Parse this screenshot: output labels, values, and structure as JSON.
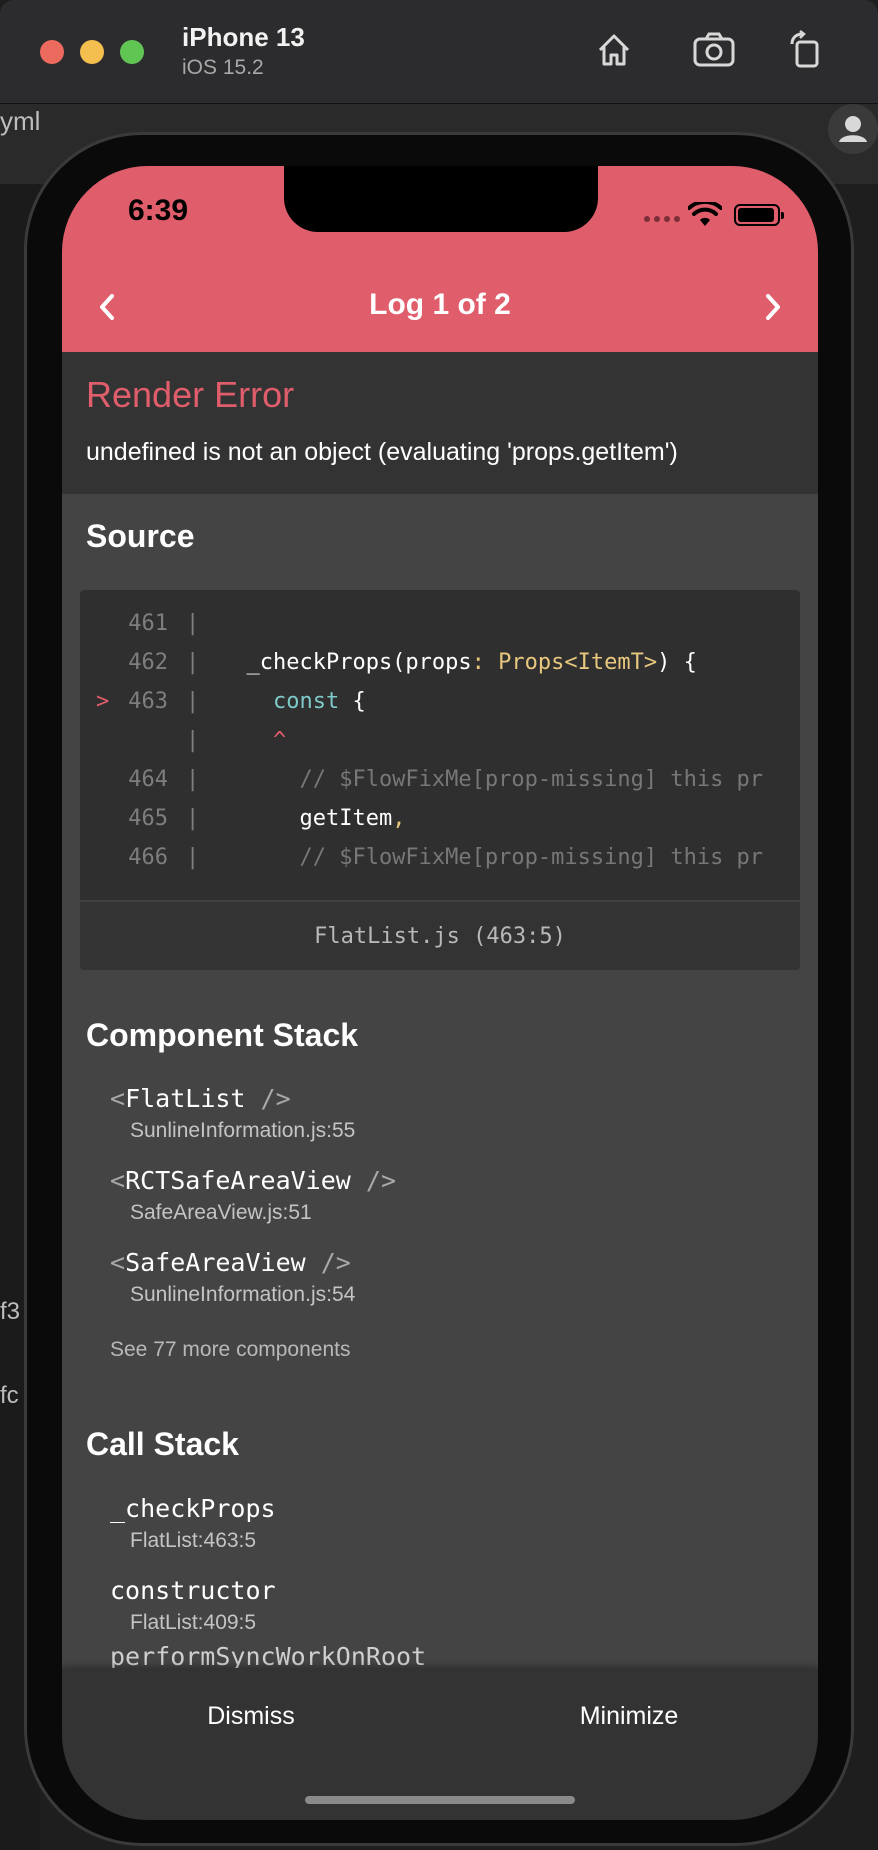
{
  "simulator": {
    "device_name": "iPhone 13",
    "os_version": "iOS 15.2",
    "toolbar_icons": [
      "home-icon",
      "screenshot-icon",
      "rotate-icon"
    ]
  },
  "background": {
    "file_fragment": "yml",
    "side_fragments": [
      "f3",
      "fc"
    ]
  },
  "status_bar": {
    "time": "6:39"
  },
  "nav": {
    "title": "Log 1 of 2"
  },
  "error": {
    "title": "Render Error",
    "message": "undefined is not an object (evaluating 'props.getItem')"
  },
  "source": {
    "heading": "Source",
    "lines": [
      {
        "marker": "",
        "num": "461",
        "parts": []
      },
      {
        "marker": "",
        "num": "462",
        "parts": [
          {
            "t": "  _checkProps(props",
            "c": ""
          },
          {
            "t": ": ",
            "c": "c-yellow"
          },
          {
            "t": "Props<ItemT>",
            "c": "c-yellow"
          },
          {
            "t": ") {",
            "c": ""
          }
        ]
      },
      {
        "marker": ">",
        "num": "463",
        "parts": [
          {
            "t": "    const",
            "c": "c-teal"
          },
          {
            "t": " {",
            "c": ""
          }
        ]
      },
      {
        "marker": "",
        "num": "",
        "parts": [
          {
            "t": "    ^",
            "c": "c-red"
          }
        ]
      },
      {
        "marker": "",
        "num": "464",
        "parts": [
          {
            "t": "      // $FlowFixMe[prop-missing] this pr",
            "c": "c-grey"
          }
        ]
      },
      {
        "marker": "",
        "num": "465",
        "parts": [
          {
            "t": "      getItem",
            "c": ""
          },
          {
            "t": ",",
            "c": "c-yellow"
          }
        ]
      },
      {
        "marker": "",
        "num": "466",
        "parts": [
          {
            "t": "      // $FlowFixMe[prop-missing] this pr",
            "c": "c-grey"
          }
        ]
      }
    ],
    "footer": "FlatList.js (463:5)"
  },
  "component_stack": {
    "heading": "Component Stack",
    "items": [
      {
        "name": "FlatList",
        "file": "SunlineInformation.js:55"
      },
      {
        "name": "RCTSafeAreaView",
        "file": "SafeAreaView.js:51"
      },
      {
        "name": "SafeAreaView",
        "file": "SunlineInformation.js:54"
      }
    ],
    "see_more": "See 77 more components"
  },
  "call_stack": {
    "heading": "Call Stack",
    "items": [
      {
        "name": "_checkProps",
        "file": "FlatList:463:5"
      },
      {
        "name": "constructor",
        "file": "FlatList:409:5"
      }
    ],
    "partial_item": "performSyncWorkOnRoot"
  },
  "footer": {
    "dismiss": "Dismiss",
    "minimize": "Minimize"
  },
  "colors": {
    "accent": "#e05d6c",
    "panel": "#333333",
    "content": "#444444"
  }
}
